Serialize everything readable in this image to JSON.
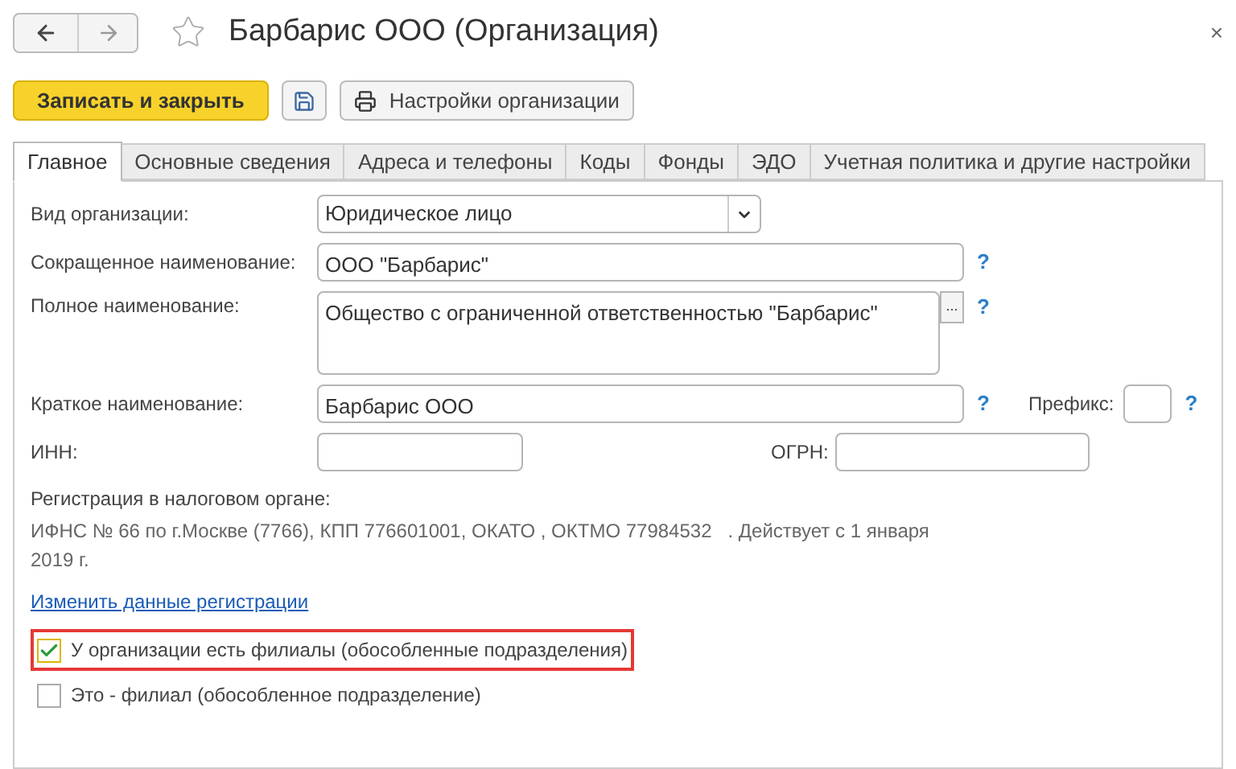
{
  "window": {
    "title": "Барбарис ООО (Организация)",
    "close": "×"
  },
  "toolbar": {
    "primary": "Записать и закрыть",
    "settings": "Настройки организации"
  },
  "tabs": [
    {
      "label": "Главное",
      "selected": true
    },
    {
      "label": "Основные сведения",
      "selected": false
    },
    {
      "label": "Адреса и телефоны",
      "selected": false
    },
    {
      "label": "Коды",
      "selected": false
    },
    {
      "label": "Фонды",
      "selected": false
    },
    {
      "label": "ЭДО",
      "selected": false
    },
    {
      "label": "Учетная политика и другие настройки",
      "selected": false
    }
  ],
  "form": {
    "org_type": {
      "label": "Вид организации:",
      "value": "Юридическое лицо"
    },
    "short_name": {
      "label": "Сокращенное наименование:",
      "value": "ООО \"Барбарис\"",
      "help": "?"
    },
    "full_name": {
      "label": "Полное наименование:",
      "value": "Общество с ограниченной ответственностью \"Барбарис\"",
      "button": "...",
      "help": "?"
    },
    "brief_name": {
      "label": "Краткое наименование:",
      "value": "Барбарис ООО",
      "help": "?"
    },
    "prefix": {
      "label": "Префикс:",
      "help": "?"
    },
    "inn": {
      "label": "ИНН:"
    },
    "ogrn": {
      "label": "ОГРН:"
    },
    "registration": {
      "label": "Регистрация в налоговом органе:",
      "text": "ИФНС № 66 по г.Москве (7766), КПП 776601001, ОКАТО , ОКТМО 77984532   . Действует с 1 января 2019 г.",
      "link": "Изменить данные регистрации"
    },
    "checkboxes": [
      {
        "label": "У организации есть филиалы (обособленные подразделения)",
        "checked": true,
        "highlighted": true
      },
      {
        "label": "Это - филиал (обособленное подразделение)",
        "checked": false,
        "highlighted": false
      }
    ]
  }
}
